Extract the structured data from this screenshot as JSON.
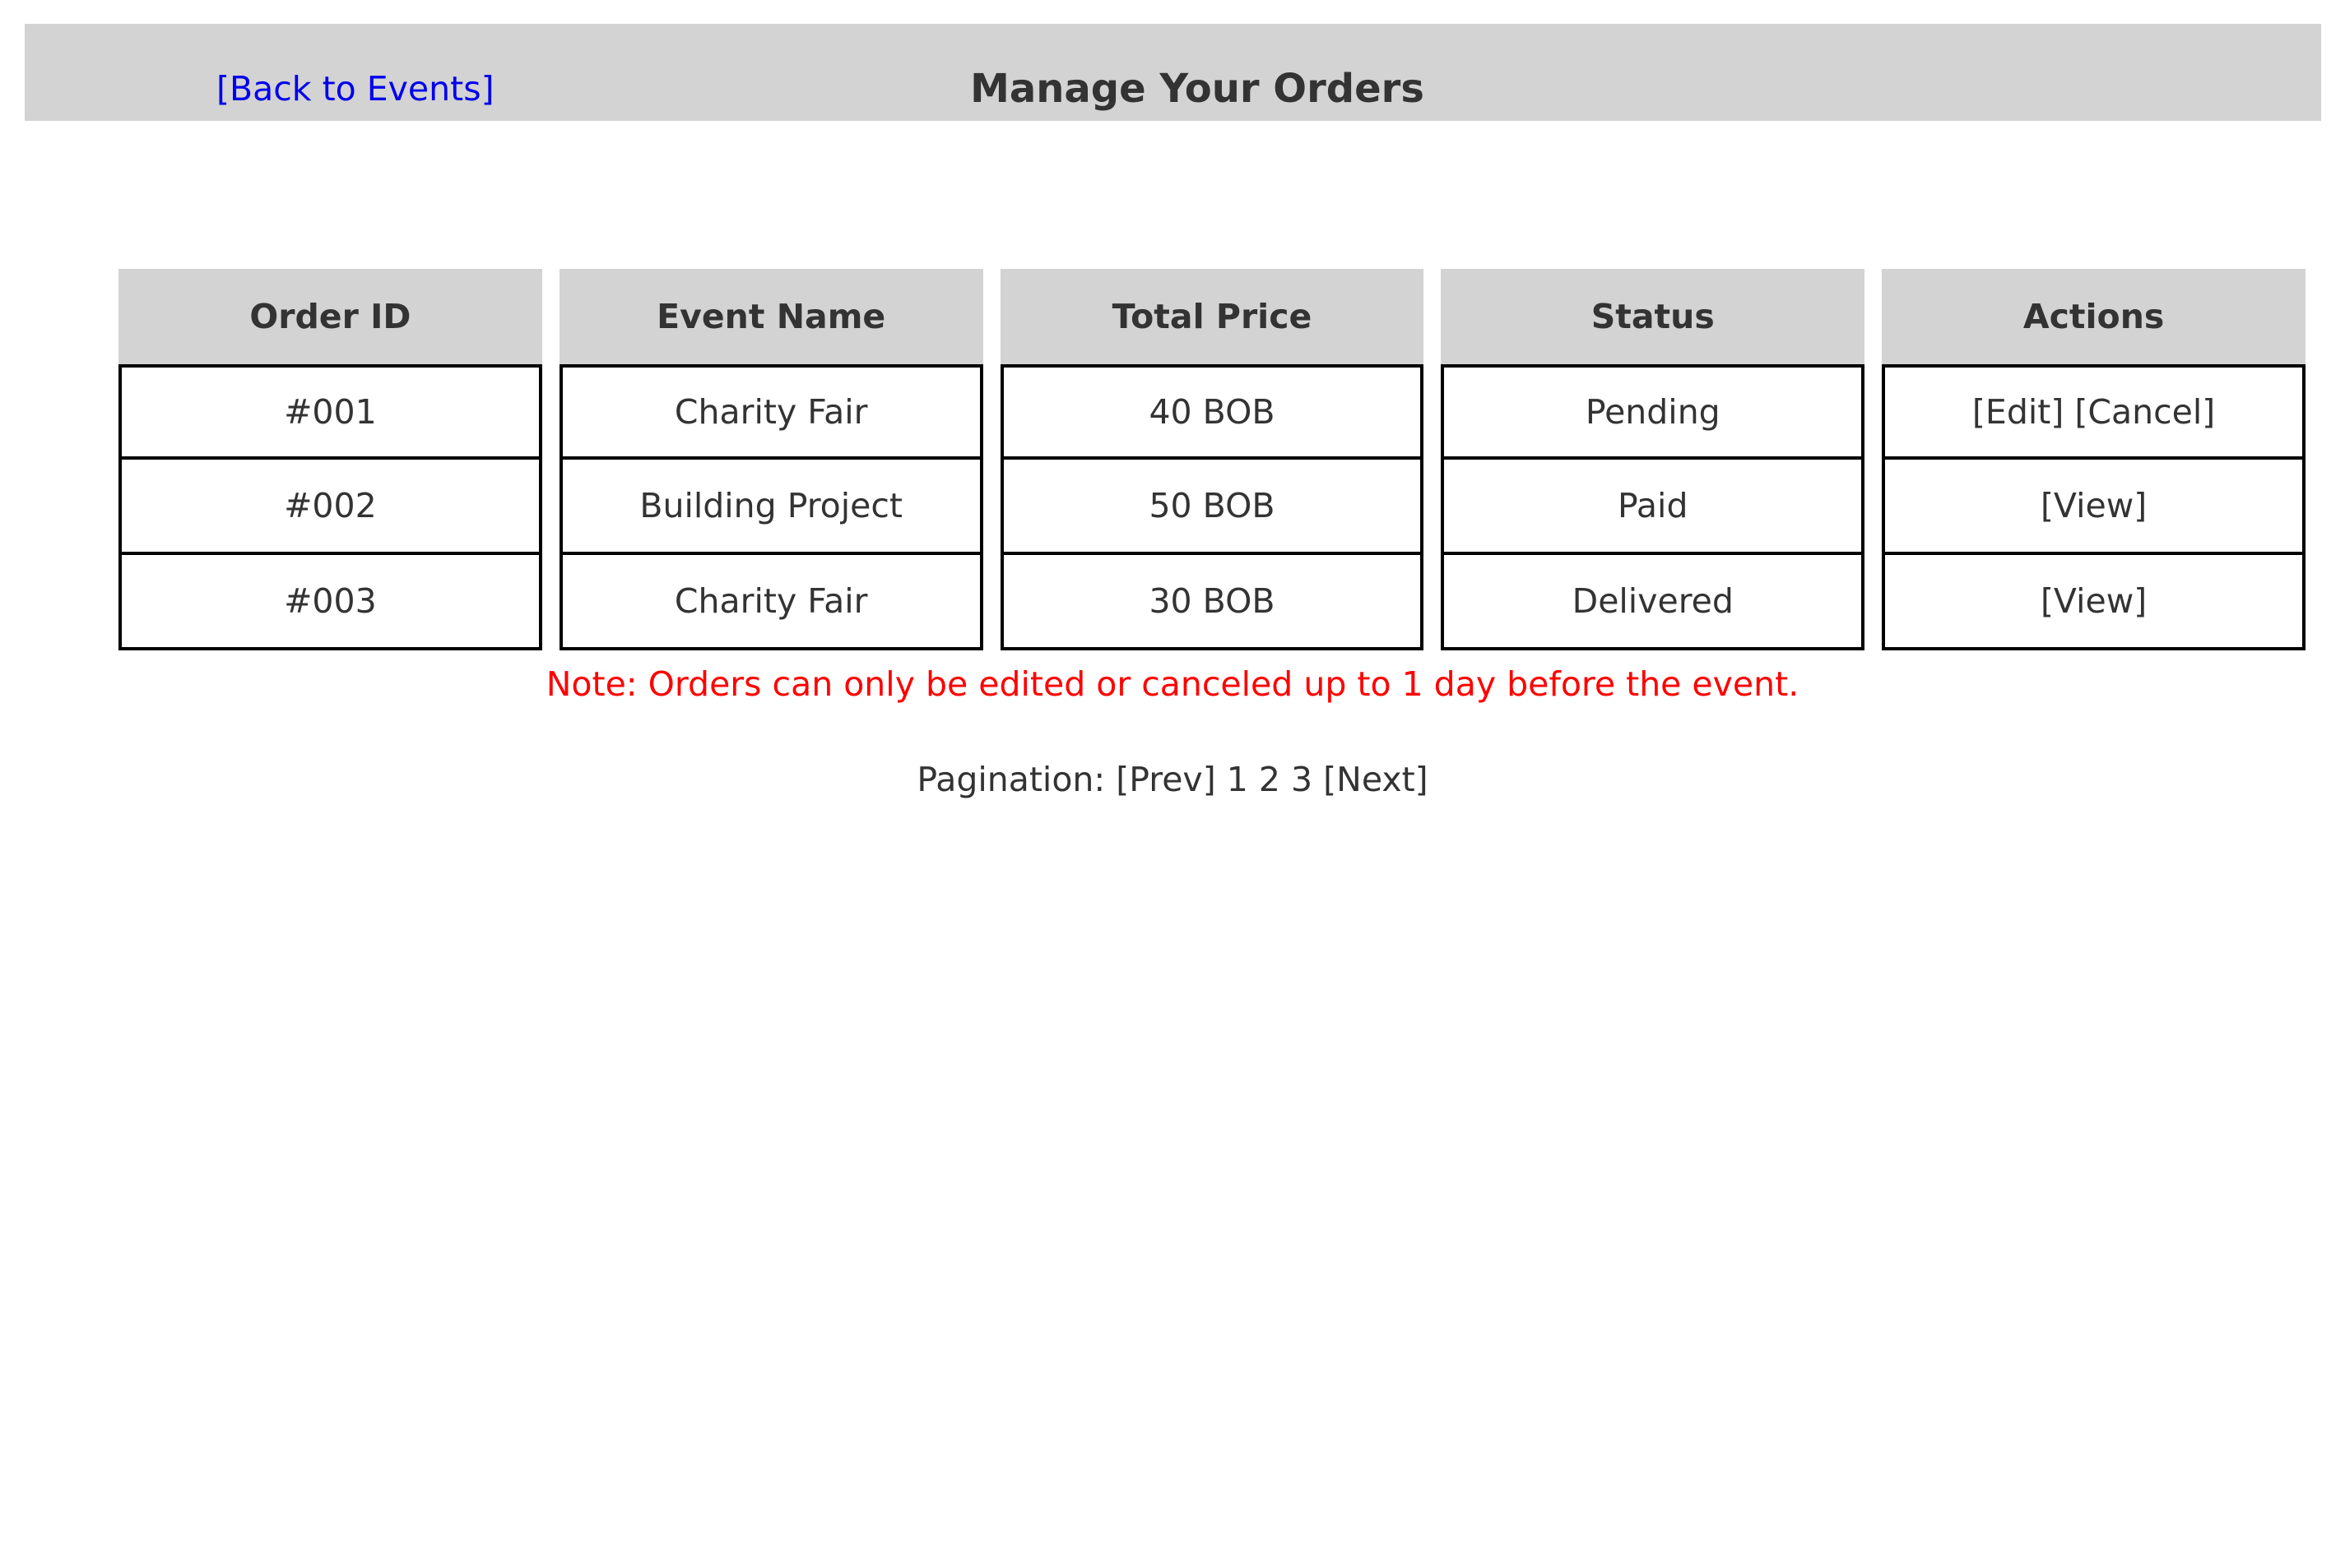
{
  "header": {
    "back_link": "[Back to Events]",
    "title": "Manage Your Orders"
  },
  "table": {
    "columns": [
      "Order ID",
      "Event Name",
      "Total Price",
      "Status",
      "Actions"
    ],
    "rows": [
      {
        "order_id": "#001",
        "event_name": "Charity Fair",
        "total_price": "40 BOB",
        "status": "Pending",
        "actions": [
          "[Edit]",
          "[Cancel]"
        ]
      },
      {
        "order_id": "#002",
        "event_name": "Building Project",
        "total_price": "50 BOB",
        "status": "Paid",
        "actions": [
          "[View]"
        ]
      },
      {
        "order_id": "#003",
        "event_name": "Charity Fair",
        "total_price": "30 BOB",
        "status": "Delivered",
        "actions": [
          "[View]"
        ]
      }
    ]
  },
  "note": "Note: Orders can only be edited or canceled up to 1 day before the event.",
  "pagination": {
    "label": "Pagination:",
    "prev": "[Prev]",
    "pages": [
      "1",
      "2",
      "3"
    ],
    "next": "[Next]"
  },
  "colors": {
    "header_bg": "#d3d3d3",
    "link": "#0000ee",
    "note": "#ff0000",
    "text": "#333333"
  }
}
